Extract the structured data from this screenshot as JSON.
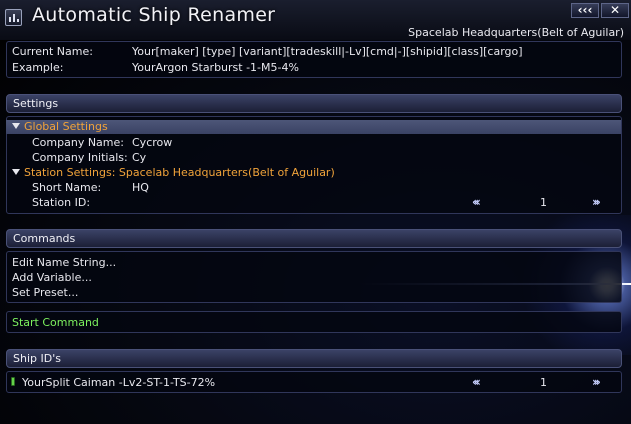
{
  "window": {
    "title": "Automatic Ship Renamer",
    "location": "Spacelab Headquarters(Belt of Aguilar)",
    "buttons": {
      "collapse": "‹‹‹",
      "close": "✕"
    }
  },
  "info": {
    "current_name_label": "Current Name:",
    "current_name_value": "Your[maker] [type] [variant][tradeskill|-Lv][cmd|-][shipid][class][cargo]",
    "example_label": "Example:",
    "example_value": "YourArgon Starburst -1-M5-4%"
  },
  "settings": {
    "header": "Settings",
    "global_group": "Global Settings",
    "company_name_label": "Company Name:",
    "company_name_value": "Cycrow",
    "company_initials_label": "Company Initials:",
    "company_initials_value": "Cy",
    "station_group": "Station Settings: Spacelab Headquarters(Belt of Aguilar)",
    "short_name_label": "Short Name:",
    "short_name_value": "HQ",
    "station_id_label": "Station ID:",
    "station_id_value": "1",
    "prev_label": "‹‹‹",
    "next_label": "›››"
  },
  "commands": {
    "header": "Commands",
    "items": [
      "Edit Name String...",
      "Add Variable...",
      "Set Preset..."
    ],
    "start": "Start Command"
  },
  "ship_ids": {
    "header": "Ship ID's",
    "entry": "YourSplit Caiman -Lv2-ST-1-TS-72%",
    "value": "1",
    "prev_label": "‹‹‹",
    "next_label": "›››"
  },
  "colors": {
    "accent_orange": "#f1a33a",
    "command_green": "#7cf05e",
    "header_blue": "#3b4266"
  }
}
